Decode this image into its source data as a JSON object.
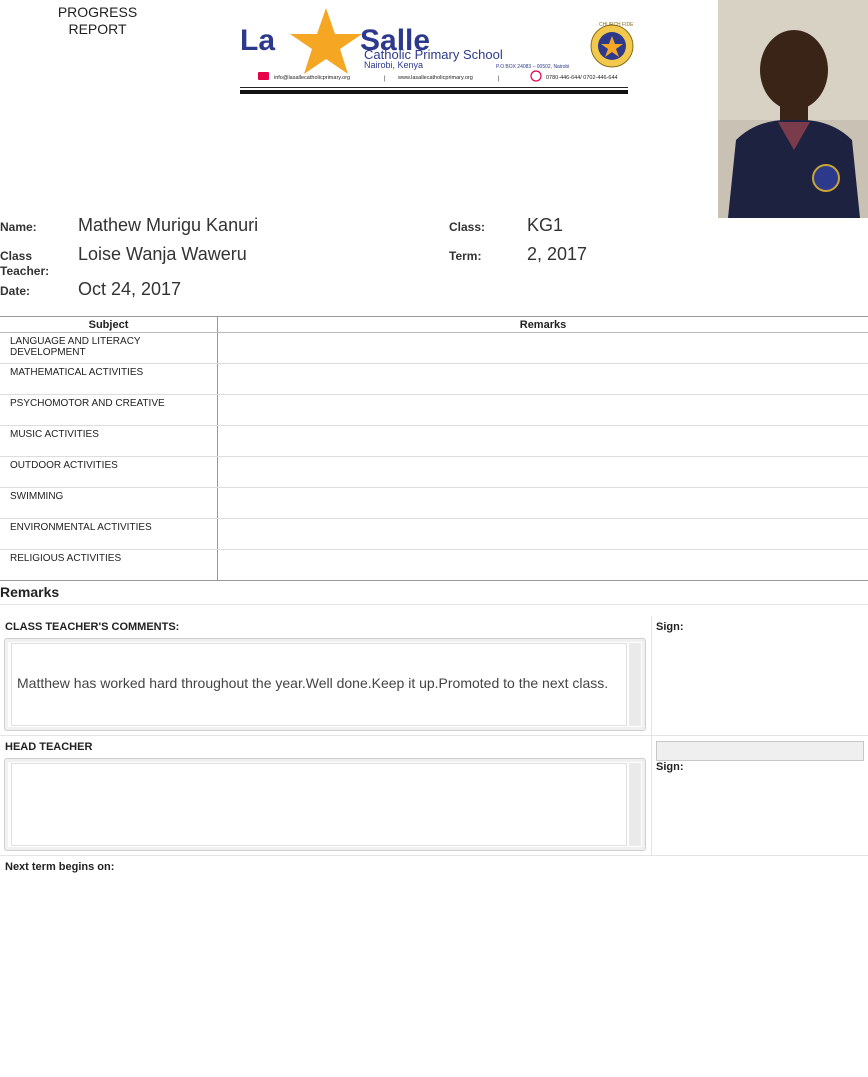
{
  "header": {
    "title_line1": "PROGRESS",
    "title_line2": "REPORT",
    "school": {
      "name_part1": "La",
      "name_part2": "Salle",
      "subtitle": "Catholic Primary School",
      "location": "Nairobi, Kenya",
      "pobox": "P.O BOX 24083 – 00502, Nairobi",
      "email": "info@lasallecatholicprimary.org",
      "website": "www.lasallecatholicprimary.org",
      "phone": "0780-446-644/ 0702-446-644",
      "crest_text": "CHURCH FIDE"
    }
  },
  "student": {
    "name_label": "Name:",
    "name": "Mathew Murigu Kanuri",
    "class_label": "Class:",
    "class": "KG1",
    "teacher_label_line1": "Class",
    "teacher_label_line2": "Teacher:",
    "teacher": "Loise Wanja Waweru",
    "term_label": "Term:",
    "term": "2, 2017",
    "date_label": "Date:",
    "date": "Oct 24, 2017"
  },
  "subjects_table": {
    "headers": [
      "Subject",
      "Remarks"
    ],
    "rows": [
      {
        "subject_line1": "LANGUAGE AND LITERACY",
        "subject_line2": "DEVELOPMENT",
        "remark": ""
      },
      {
        "subject_line1": "MATHEMATICAL ACTIVITIES",
        "subject_line2": "",
        "remark": ""
      },
      {
        "subject_line1": "PSYCHOMOTOR AND CREATIVE",
        "subject_line2": "",
        "remark": ""
      },
      {
        "subject_line1": "MUSIC ACTIVITIES",
        "subject_line2": "",
        "remark": ""
      },
      {
        "subject_line1": "OUTDOOR ACTIVITIES",
        "subject_line2": "",
        "remark": ""
      },
      {
        "subject_line1": "SWIMMING",
        "subject_line2": "",
        "remark": ""
      },
      {
        "subject_line1": "ENVIRONMENTAL ACTIVITIES",
        "subject_line2": "",
        "remark": ""
      },
      {
        "subject_line1": "RELIGIOUS ACTIVITIES",
        "subject_line2": "",
        "remark": ""
      }
    ]
  },
  "remarks": {
    "heading": "Remarks",
    "class_teacher_label": "CLASS TEACHER'S COMMENTS:",
    "class_teacher_comment": "Matthew has worked hard throughout the year.Well done.Keep it up.Promoted to the next class.",
    "sign_label": "Sign:",
    "head_teacher_label": "HEAD TEACHER",
    "head_teacher_comment": "",
    "head_sign_label": "Sign:",
    "head_sign_value": "",
    "next_term_label": "Next term begins on:"
  },
  "colors": {
    "brand_blue": "#2d3a8c",
    "star_orange": "#f5a623",
    "accent_red": "#e6004c"
  }
}
